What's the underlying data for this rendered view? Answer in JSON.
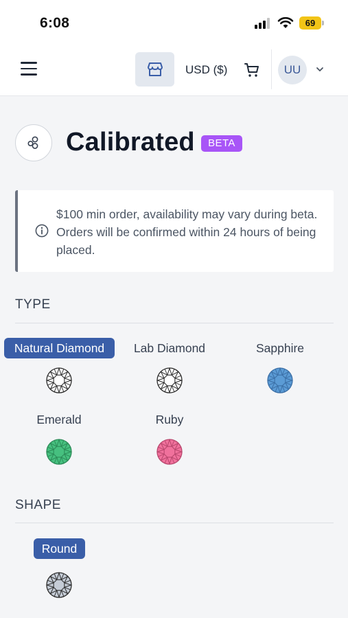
{
  "status_bar": {
    "time": "6:08",
    "battery": "69"
  },
  "nav": {
    "currency": "USD ($)",
    "avatar_initials": "UU"
  },
  "page": {
    "title": "Calibrated",
    "badge": "BETA",
    "notice": "$100 min order, availability may vary during beta. Orders will be confirmed within 24 hours of being placed."
  },
  "type_section": {
    "title": "TYPE",
    "options": [
      {
        "label": "Natural Diamond",
        "selected": true,
        "color": "#ffffff"
      },
      {
        "label": "Lab Diamond",
        "selected": false,
        "color": "#ffffff"
      },
      {
        "label": "Sapphire",
        "selected": false,
        "color": "#5b9bd5"
      },
      {
        "label": "Emerald",
        "selected": false,
        "color": "#46c07f"
      },
      {
        "label": "Ruby",
        "selected": false,
        "color": "#f0719c"
      }
    ]
  },
  "shape_section": {
    "title": "SHAPE",
    "options": [
      {
        "label": "Round",
        "selected": true,
        "color": "#c5ccd6"
      }
    ]
  },
  "colors": {
    "accent": "#3a5ea8",
    "beta": "#a855f7"
  }
}
